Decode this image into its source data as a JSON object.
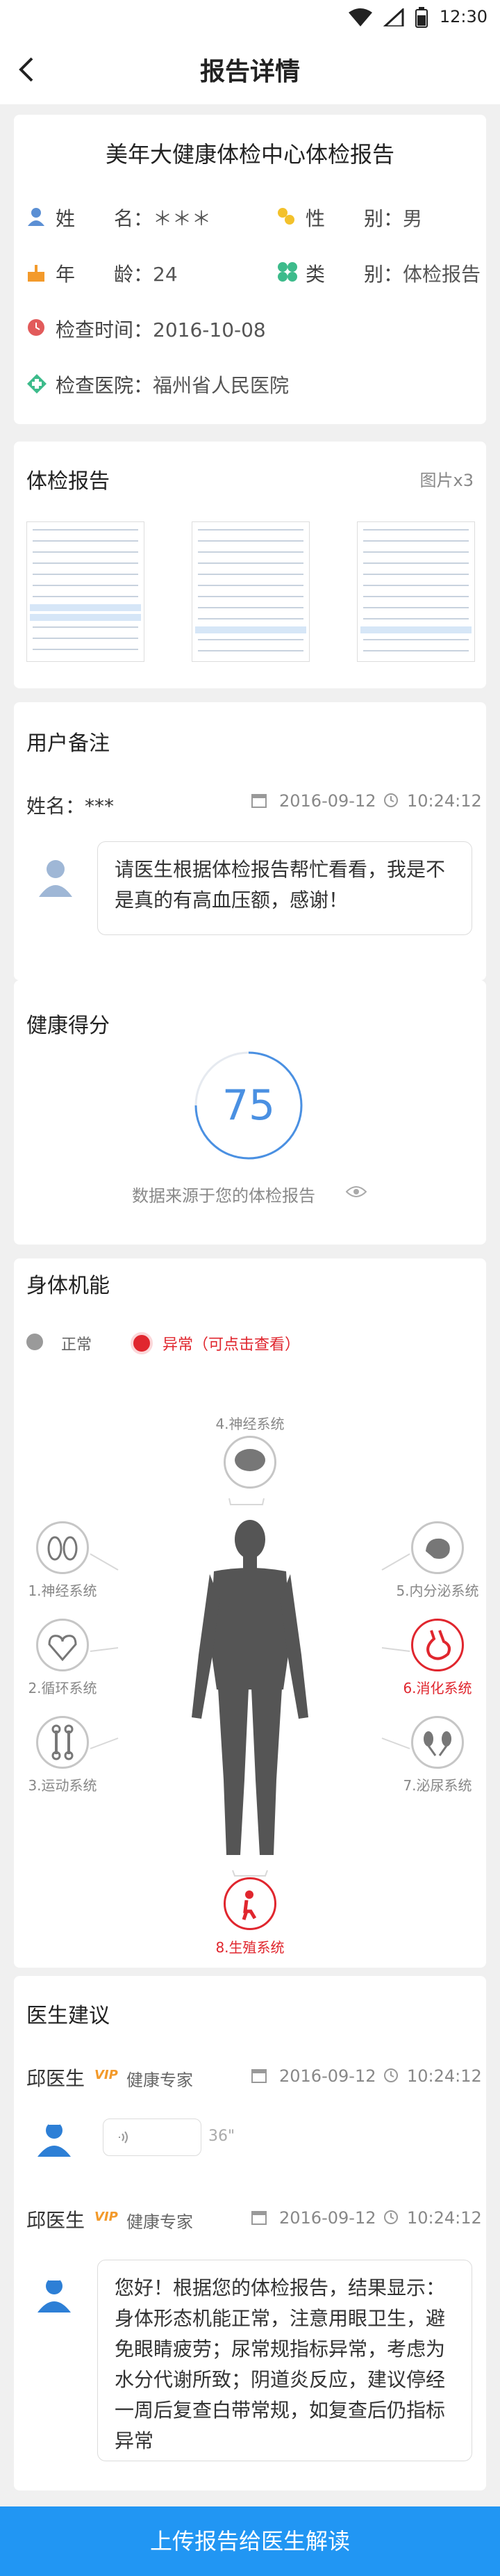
{
  "status": {
    "time": "12:30"
  },
  "nav": {
    "title": "报告详情"
  },
  "header": {
    "title": "美年大健康体检中心体检报告",
    "name_label": "姓　　名：",
    "name_value": "＊＊＊",
    "gender_label": "性　　别：",
    "gender_value": "男",
    "age_label": "年　　龄：",
    "age_value": "24",
    "type_label": "类　　别：",
    "type_value": "体检报告",
    "date_label": "检查时间：",
    "date_value": "2016-10-08",
    "hospital_label": "检查医院：",
    "hospital_value": "福州省人民医院"
  },
  "report": {
    "title": "体检报告",
    "count": "图片x3"
  },
  "notes": {
    "title": "用户备注",
    "name": "姓名：***",
    "date": "2016-09-12",
    "time": "10:24:12",
    "message": "请医生根据体检报告帮忙看看，我是不是真的有高血压额，感谢！"
  },
  "score": {
    "title": "健康得分",
    "value": "75",
    "fraction": 0.75,
    "source": "数据来源于您的体检报告"
  },
  "body": {
    "title": "身体机能",
    "legend_normal": "正常",
    "legend_abnormal": "异常（可点击查看）",
    "organs": {
      "top": "4.神经系统",
      "left1": "1.神经系统",
      "left2": "2.循环系统",
      "left3": "3.运动系统",
      "right1": "5.内分泌系统",
      "right2": "6.消化系统",
      "right3": "7.泌尿系统",
      "bottom": "8.生殖系统"
    },
    "colors": {
      "normal": "#9a9a9a",
      "abnormal": "#e0262e",
      "silhouette": "#555555"
    }
  },
  "advice": {
    "title": "医生建议",
    "item1": {
      "doctor": "邱医生",
      "vip": "VIP",
      "role": "健康专家",
      "date": "2016-09-12",
      "time": "10:24:12",
      "voice": "36\""
    },
    "item2": {
      "doctor": "邱医生",
      "vip": "VIP",
      "role": "健康专家",
      "date": "2016-09-12",
      "time": "10:24:12",
      "message": "您好！根据您的体检报告，结果显示：身体形态机能正常，注意用眼卫生，避免眼睛疲劳；尿常规指标异常，考虑为水分代谢所致；阴道炎反应，建议停经一周后复查白带常规，如复查后仍指标异常"
    }
  },
  "bottom_button": "上传报告给医生解读",
  "accent": "#2196f3"
}
